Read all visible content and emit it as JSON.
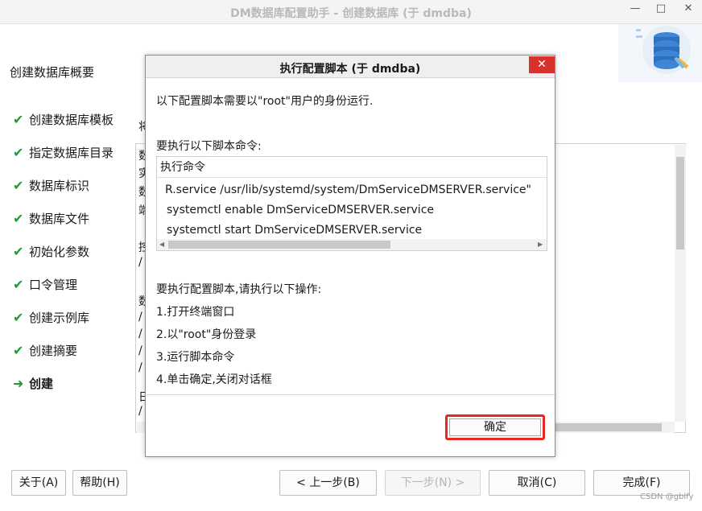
{
  "window": {
    "title": "DM数据库配置助手 - 创建数据库 (于 dmdba)",
    "min_glyph": "—",
    "max_glyph": "□",
    "close_glyph": "✕"
  },
  "header": {
    "title": "创建数据库概要",
    "logo_icon": "database-icon"
  },
  "sidebar": {
    "items": [
      {
        "label": "创建数据库模板",
        "status": "done"
      },
      {
        "label": "指定数据库目录",
        "status": "done"
      },
      {
        "label": "数据库标识",
        "status": "done"
      },
      {
        "label": "数据库文件",
        "status": "done"
      },
      {
        "label": "初始化参数",
        "status": "done"
      },
      {
        "label": "口令管理",
        "status": "done"
      },
      {
        "label": "创建示例库",
        "status": "done"
      },
      {
        "label": "创建摘要",
        "status": "done"
      },
      {
        "label": "创建",
        "status": "current"
      }
    ],
    "done_glyph": "✔",
    "current_glyph": "➜"
  },
  "background": {
    "partial_label": "将",
    "area_partial_lines": [
      "数",
      "实",
      "数",
      "端",
      "",
      "控",
      "/",
      "",
      "数",
      "/",
      "/",
      "/",
      "/",
      "",
      "日",
      "/",
      "/"
    ]
  },
  "buttons": {
    "about": "关于(A)",
    "help": "帮助(H)",
    "prev": "< 上一步(B)",
    "next": "下一步(N) >",
    "cancel": "取消(C)",
    "finish": "完成(F)"
  },
  "dialog": {
    "title": "执行配置脚本 (于 dmdba)",
    "close_glyph": "✕",
    "intro": "以下配置脚本需要以\"root\"用户的身份运行.",
    "commands_label": "要执行以下脚本命令:",
    "cmd_header": "执行命令",
    "commands": [
      "R.service /usr/lib/systemd/system/DmServiceDMSERVER.service\"",
      "systemctl enable DmServiceDMSERVER.service",
      "systemctl start DmServiceDMSERVER.service"
    ],
    "ops_label": "要执行配置脚本,请执行以下操作:",
    "steps": [
      "1.打开终端窗口",
      "2.以\"root\"身份登录",
      "3.运行脚本命令",
      "4.单击确定,关闭对话框"
    ],
    "ok_label": "确定",
    "accent_color": "#e8291f"
  },
  "watermark": "CSDN @gblfy"
}
